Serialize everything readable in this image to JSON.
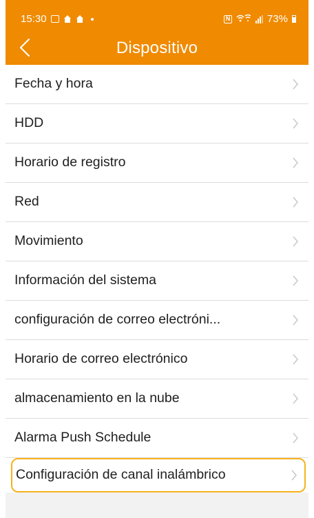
{
  "status_bar": {
    "time": "15:30",
    "battery": "73%",
    "left_icons": [
      "image-icon",
      "home-signal-icon",
      "home-icon",
      "dot-icon"
    ],
    "right_icons": [
      "nfc-icon",
      "wifi-icon",
      "signal-icon",
      "battery-icon"
    ]
  },
  "header": {
    "title": "Dispositivo",
    "back_icon": "chevron-left-icon",
    "background": "#f08a00",
    "text_color": "#ffffff"
  },
  "menu": {
    "items": [
      {
        "label": "Fecha y hora"
      },
      {
        "label": "HDD"
      },
      {
        "label": "Horario de registro"
      },
      {
        "label": "Red"
      },
      {
        "label": "Movimiento"
      },
      {
        "label": "Información del sistema"
      },
      {
        "label": "configuración de correo electróni..."
      },
      {
        "label": "Horario de correo electrónico"
      },
      {
        "label": "almacenamiento en la nube"
      },
      {
        "label": "Alarma Push Schedule"
      },
      {
        "label": "Configuración de canal inalámbrico",
        "highlighted": true,
        "highlight_color": "#f6b21c"
      }
    ],
    "chevron_icon": "chevron-right-icon",
    "chevron_color": "#c8c8c8"
  }
}
